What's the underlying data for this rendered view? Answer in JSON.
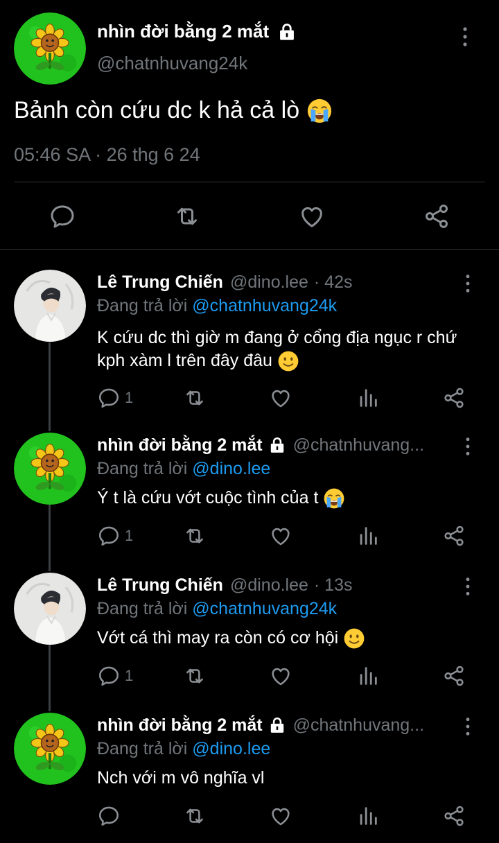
{
  "main_tweet": {
    "author_name": "nhìn đời bằng 2 mắt",
    "handle": "@chatnhuvang24k",
    "text": "Bảnh còn cứu dc k hả cả lò",
    "timestamp": "05:46 SA · 26 thg 6 24"
  },
  "replies": [
    {
      "author_name": "Lê Trung Chiến",
      "handle": "@dino.lee",
      "time": "· 42s",
      "replying_prefix": "Đang trả lời",
      "replying_to": "@chatnhuvang24k",
      "text": "K cứu dc thì giờ m đang ở cổng địa ngục r chứ kph xàm l trên đây đâu",
      "reply_count": "1"
    },
    {
      "author_name": "nhìn đời bằng 2 mắt",
      "handle": "@chatnhuvang...",
      "time": "",
      "replying_prefix": "Đang trả lời",
      "replying_to": "@dino.lee",
      "text": "Ý t là cứu vớt cuộc tình của t",
      "reply_count": "1"
    },
    {
      "author_name": "Lê Trung Chiến",
      "handle": "@dino.lee",
      "time": "· 13s",
      "replying_prefix": "Đang trả lời",
      "replying_to": "@chatnhuvang24k",
      "text": "Vớt cá thì may ra còn có cơ hội",
      "reply_count": "1"
    },
    {
      "author_name": "nhìn đời bằng 2 mắt",
      "handle": "@chatnhuvang...",
      "time": "",
      "replying_prefix": "Đang trả lời",
      "replying_to": "@dino.lee",
      "text": "Nch với m vô nghĩa vl",
      "reply_count": ""
    }
  ],
  "icons": {
    "reply": "reply-icon",
    "retweet": "retweet-icon",
    "like": "like-icon",
    "views": "views-icon",
    "share": "share-icon",
    "lock": "lock-icon",
    "more": "more-icon"
  },
  "colors": {
    "background": "#000000",
    "link": "#1d9bf0",
    "muted": "#71767b",
    "avatar_green": "#1fbf1f"
  }
}
